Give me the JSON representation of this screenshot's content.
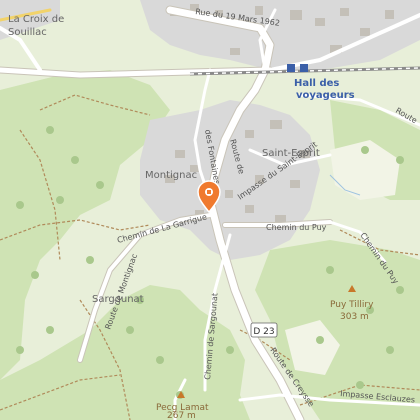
{
  "map": {
    "places": {
      "la_croix": "La Croix de",
      "souillac": "Souillac",
      "montignac": "Montignac",
      "saint_esprit": "Saint-Esprit",
      "sargounat": "Sargounat"
    },
    "station": {
      "line1": "Hall des",
      "line2": "voyageurs"
    },
    "peaks": [
      {
        "name": "Puy Tilliry",
        "elevation": "303 m"
      },
      {
        "name": "Pecg Lamat",
        "elevation": "267 m"
      }
    ],
    "roads": {
      "rue_19_mars": "Rue du 19 Mars 1962",
      "route_de": "Route de",
      "des_fontaines": "des Fontaines",
      "impasse_st_esprit": "Impasse du Saint-Esprit",
      "chemin_garrigue": "Chemin de La Garrigue",
      "chemin_puy": "Chemin du Puy",
      "chemin_puy_2": "Chemin du Puy",
      "route_montignac": "Route de Montignac",
      "chemin_sargounat": "Chemin de Sargounat",
      "route_creysse": "Route de Creysse",
      "impasse_esclauzes": "Impasse Esclauzes",
      "route_right": "Route",
      "d23": "D 23"
    },
    "marker_icon": "location-pin-icon",
    "colors": {
      "forest": "#cfe3b4",
      "meadow": "#e3edd2",
      "urban": "#dcdcdc",
      "road": "#ffffff",
      "marker": "#f07a2e",
      "station": "#3b5fa8"
    }
  }
}
